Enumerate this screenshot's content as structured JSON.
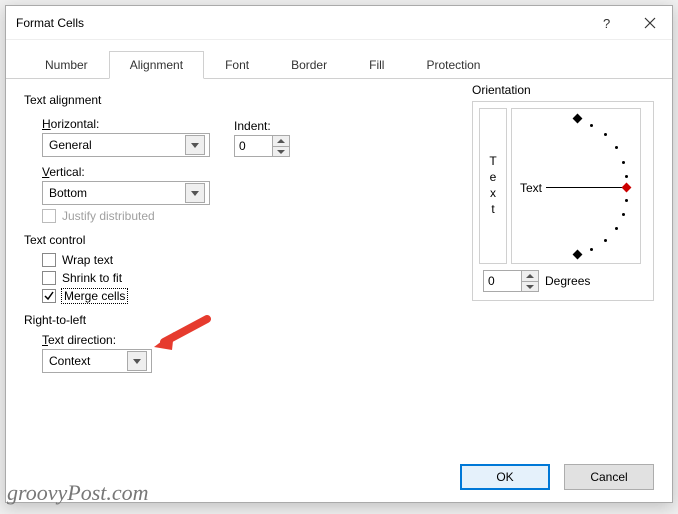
{
  "dialog": {
    "title": "Format Cells"
  },
  "tabs": [
    "Number",
    "Alignment",
    "Font",
    "Border",
    "Fill",
    "Protection"
  ],
  "active_tab": 1,
  "alignment": {
    "group_label": "Text alignment",
    "horizontal_label": "Horizontal:",
    "horizontal_value": "General",
    "indent_label": "Indent:",
    "indent_value": "0",
    "vertical_label": "Vertical:",
    "vertical_value": "Bottom",
    "justify_distributed_label": "Justify distributed"
  },
  "text_control": {
    "group_label": "Text control",
    "wrap_label": "Wrap text",
    "wrap_checked": false,
    "shrink_label": "Shrink to fit",
    "shrink_checked": false,
    "merge_label": "Merge cells",
    "merge_checked": true
  },
  "rtl": {
    "group_label": "Right-to-left",
    "direction_label": "Text direction:",
    "direction_value": "Context"
  },
  "orientation": {
    "group_label": "Orientation",
    "vertical_text": "Text",
    "dial_label": "Text",
    "degrees_value": "0",
    "degrees_label": "Degrees"
  },
  "buttons": {
    "ok": "OK",
    "cancel": "Cancel"
  },
  "watermark": "groovyPost.com"
}
